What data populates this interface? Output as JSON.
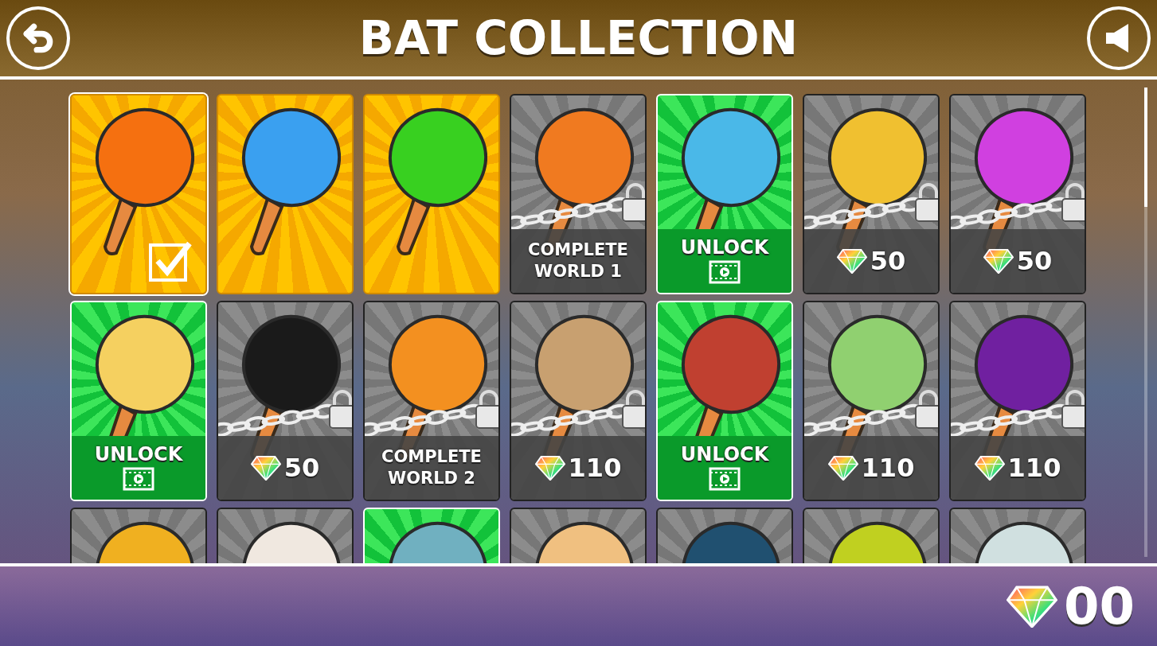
{
  "title": "BAT COLLECTION",
  "cards": [
    {
      "kind": "owned",
      "selected": true,
      "color": "#f57010"
    },
    {
      "kind": "owned",
      "selected": false,
      "color": "#3aa0f0"
    },
    {
      "kind": "owned",
      "selected": false,
      "color": "#38d020"
    },
    {
      "kind": "locked",
      "selected": false,
      "color": "#f07a20",
      "requirement": "COMPLETE WORLD 1"
    },
    {
      "kind": "video",
      "selected": false,
      "color": "#4ab8e8",
      "label": "UNLOCK"
    },
    {
      "kind": "locked",
      "selected": false,
      "color": "#f0c030",
      "price": "50"
    },
    {
      "kind": "locked",
      "selected": false,
      "color": "#d040e0",
      "price": "50"
    },
    {
      "kind": "video",
      "selected": false,
      "color": "#f5d060",
      "label": "UNLOCK"
    },
    {
      "kind": "locked",
      "selected": false,
      "color": "#1a1a1a",
      "price": "50"
    },
    {
      "kind": "locked",
      "selected": false,
      "color": "#f39020",
      "requirement": "COMPLETE WORLD 2"
    },
    {
      "kind": "locked",
      "selected": false,
      "color": "#c8a070",
      "price": "110"
    },
    {
      "kind": "video",
      "selected": false,
      "color": "#c04030",
      "label": "UNLOCK"
    },
    {
      "kind": "locked",
      "selected": false,
      "color": "#90d070",
      "price": "110"
    },
    {
      "kind": "locked",
      "selected": false,
      "color": "#7020a0",
      "price": "110"
    },
    {
      "kind": "locked",
      "selected": false,
      "color": "#f0b020"
    },
    {
      "kind": "locked",
      "selected": false,
      "color": "#f0e8e0"
    },
    {
      "kind": "video",
      "selected": false,
      "color": "#70b0c0"
    },
    {
      "kind": "locked",
      "selected": false,
      "color": "#f0c080"
    },
    {
      "kind": "locked",
      "selected": false,
      "color": "#205070"
    },
    {
      "kind": "locked",
      "selected": false,
      "color": "#c0d020"
    },
    {
      "kind": "locked",
      "selected": false,
      "color": "#d0e0e0"
    }
  ],
  "gems": "00"
}
